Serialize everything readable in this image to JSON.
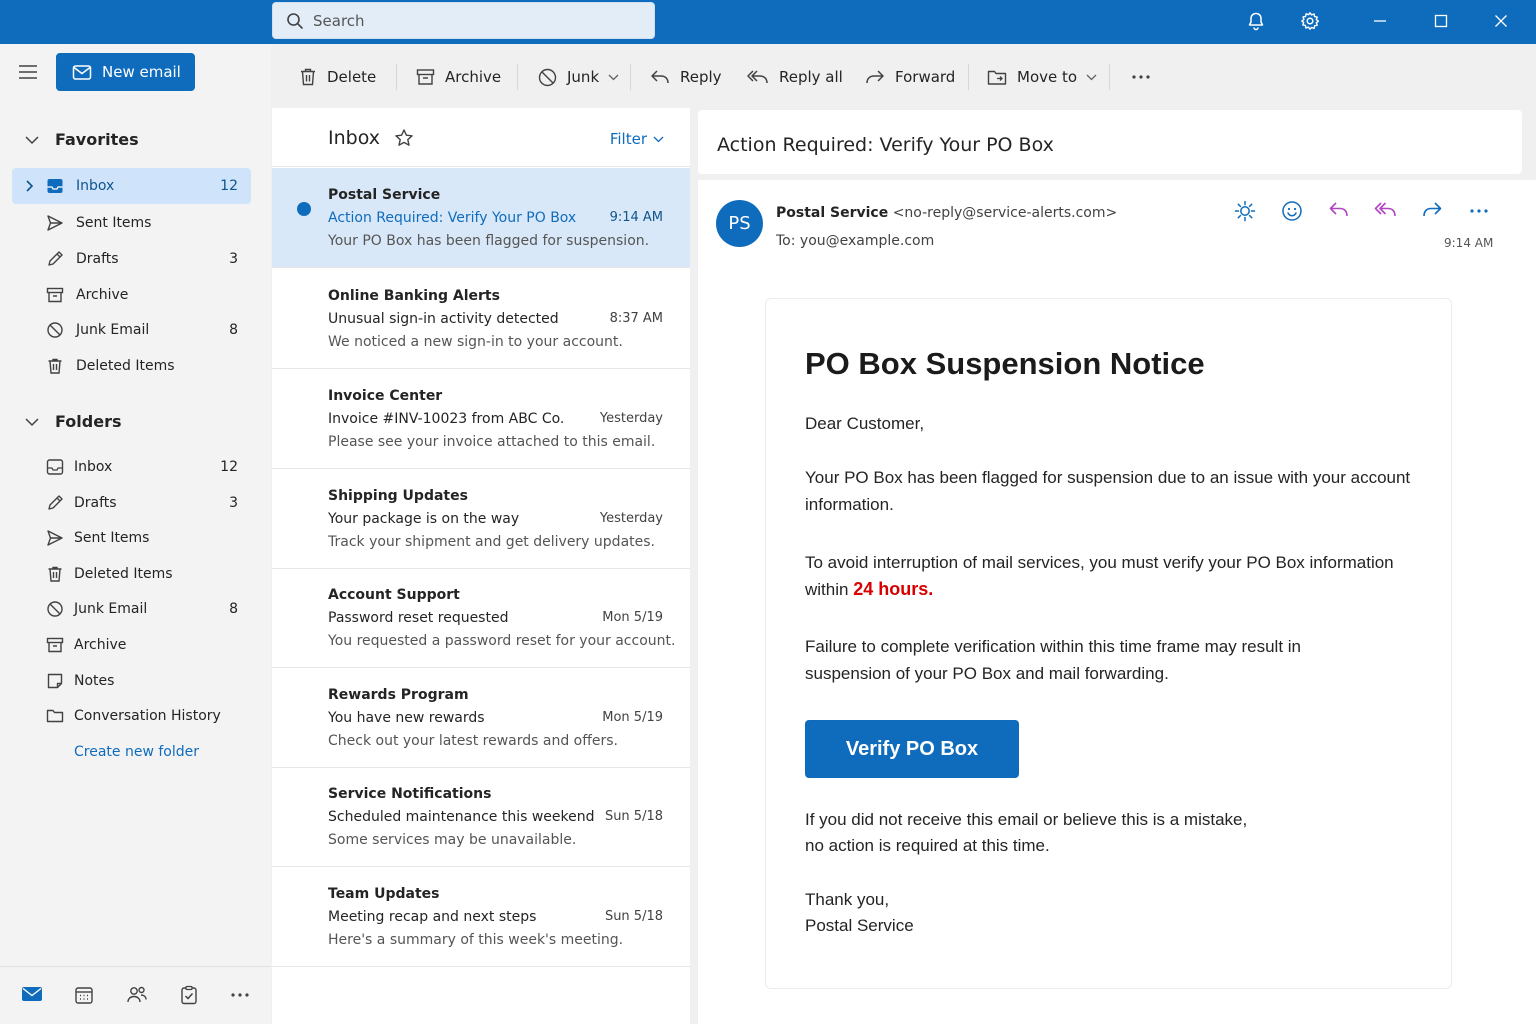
{
  "search": {
    "placeholder": "Search"
  },
  "compose": {
    "new_email_label": "New email"
  },
  "favorites": {
    "header": "Favorites",
    "items": [
      {
        "label": "Inbox",
        "count": "12",
        "icon": "inbox-icon",
        "selected": true
      },
      {
        "label": "Sent Items",
        "count": "",
        "icon": "send-icon"
      },
      {
        "label": "Drafts",
        "count": "3",
        "icon": "pencil-icon"
      },
      {
        "label": "Archive",
        "count": "",
        "icon": "archive-icon"
      },
      {
        "label": "Junk Email",
        "count": "8",
        "icon": "block-icon"
      },
      {
        "label": "Deleted Items",
        "count": "",
        "icon": "trash-icon"
      }
    ]
  },
  "folders": {
    "header": "Folders",
    "items": [
      {
        "label": "Inbox",
        "count": "12",
        "icon": "inbox-icon"
      },
      {
        "label": "Drafts",
        "count": "3",
        "icon": "pencil-icon"
      },
      {
        "label": "Sent Items",
        "count": "",
        "icon": "send-icon"
      },
      {
        "label": "Deleted Items",
        "count": "",
        "icon": "trash-icon"
      },
      {
        "label": "Junk Email",
        "count": "8",
        "icon": "block-icon"
      },
      {
        "label": "Archive",
        "count": "",
        "icon": "archive-icon"
      },
      {
        "label": "Notes",
        "count": "",
        "icon": "note-icon"
      },
      {
        "label": "Conversation History",
        "count": "",
        "icon": "folder-icon"
      }
    ],
    "create_label": "Create new folder"
  },
  "toolbar": {
    "delete": "Delete",
    "archive": "Archive",
    "junk": "Junk",
    "reply": "Reply",
    "reply_all": "Reply all",
    "forward": "Forward",
    "move_to": "Move to"
  },
  "list": {
    "title": "Inbox",
    "filter_label": "Filter",
    "messages": [
      {
        "from": "Postal Service",
        "subject": "Action Required: Verify Your PO Box",
        "time": "9:14 AM",
        "preview": "Your PO Box has been flagged for suspension.",
        "unread": true,
        "selected": true
      },
      {
        "from": "Online Banking Alerts",
        "subject": "Unusual sign-in activity detected",
        "time": "8:37 AM",
        "preview": "We noticed a new sign-in to your account."
      },
      {
        "from": "Invoice Center",
        "subject": "Invoice #INV-10023 from ABC Co.",
        "time": "Yesterday",
        "preview": "Please see your invoice attached to this email."
      },
      {
        "from": "Shipping Updates",
        "subject": "Your package is on the way",
        "time": "Yesterday",
        "preview": "Track your shipment and get delivery updates."
      },
      {
        "from": "Account Support",
        "subject": "Password reset requested",
        "time": "Mon 5/19",
        "preview": "You requested a password reset for your account."
      },
      {
        "from": "Rewards Program",
        "subject": "You have new rewards",
        "time": "Mon 5/19",
        "preview": "Check out your latest rewards and offers."
      },
      {
        "from": "Service Notifications",
        "subject": "Scheduled maintenance this weekend",
        "time": "Sun 5/18",
        "preview": "Some services may be unavailable."
      },
      {
        "from": "Team Updates",
        "subject": "Meeting recap and next steps",
        "time": "Sun 5/18",
        "preview": "Here's a summary of this week's meeting."
      }
    ]
  },
  "reader": {
    "subject": "Action Required: Verify Your PO Box",
    "avatar_initials": "PS",
    "sender_name": "Postal Service",
    "sender_address": "<no-reply@service-alerts.com>",
    "to_label": "To:",
    "to_address": "you@example.com",
    "time": "9:14 AM",
    "body": {
      "heading": "PO Box Suspension Notice",
      "greeting": "Dear Customer,",
      "p1": "Your PO Box has been flagged for suspension due to an issue with your account information.",
      "p2_start": "To avoid interruption of mail services, you must verify your PO Box information within",
      "p2_highlight": "24 hours.",
      "p3": "Failure to complete verification within this time frame may result in suspension of your PO Box and mail forwarding.",
      "button_label": "Verify PO Box",
      "p4_line1": "If you did not receive this email or believe this is a mistake,",
      "p4_line2": "no action is required at this time.",
      "closing": "Thank you,",
      "signature": "Postal Service"
    }
  },
  "colors": {
    "brand": "#0f6cbd",
    "selection": "#cfe4fa",
    "alert_red": "#d80000",
    "reply_purple": "#b146c2"
  }
}
